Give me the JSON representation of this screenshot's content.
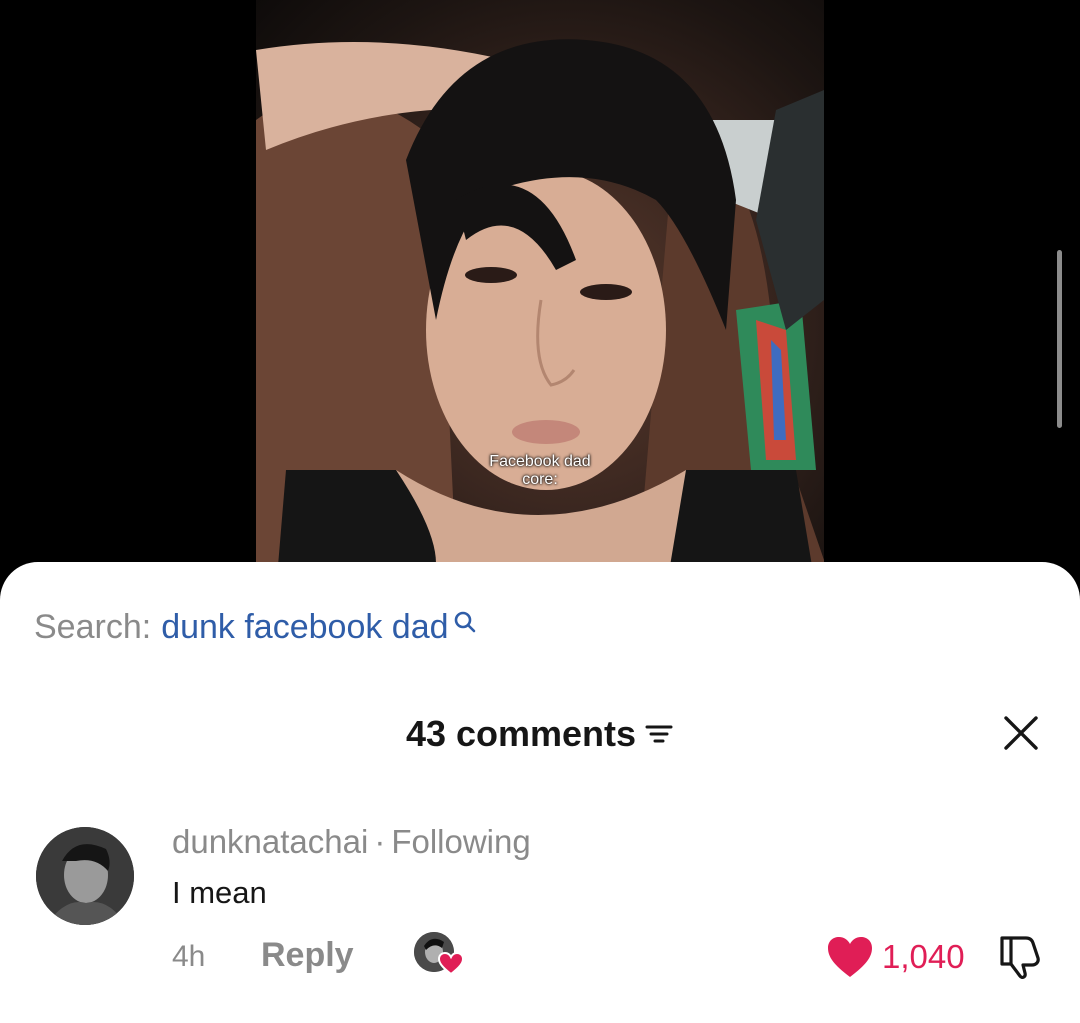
{
  "video": {
    "caption_line1": "Facebook dad",
    "caption_line2": "core:"
  },
  "search": {
    "prefix": "Search:",
    "query": "dunk facebook dad",
    "icon": "search-icon"
  },
  "comments_header": {
    "count_label": "43 comments",
    "filter_icon": "filter-icon",
    "close_icon": "close-icon"
  },
  "comment": {
    "author": "dunknatachai",
    "separator": "·",
    "relation": "Following",
    "text": "I mean",
    "time": "4h",
    "reply_label": "Reply",
    "like_count": "1,040",
    "liked": true
  },
  "colors": {
    "accent_link": "#2f5da8",
    "like_red": "#e01e56",
    "muted_text": "#8a8a8a",
    "sheet_bg": "#ffffff"
  }
}
